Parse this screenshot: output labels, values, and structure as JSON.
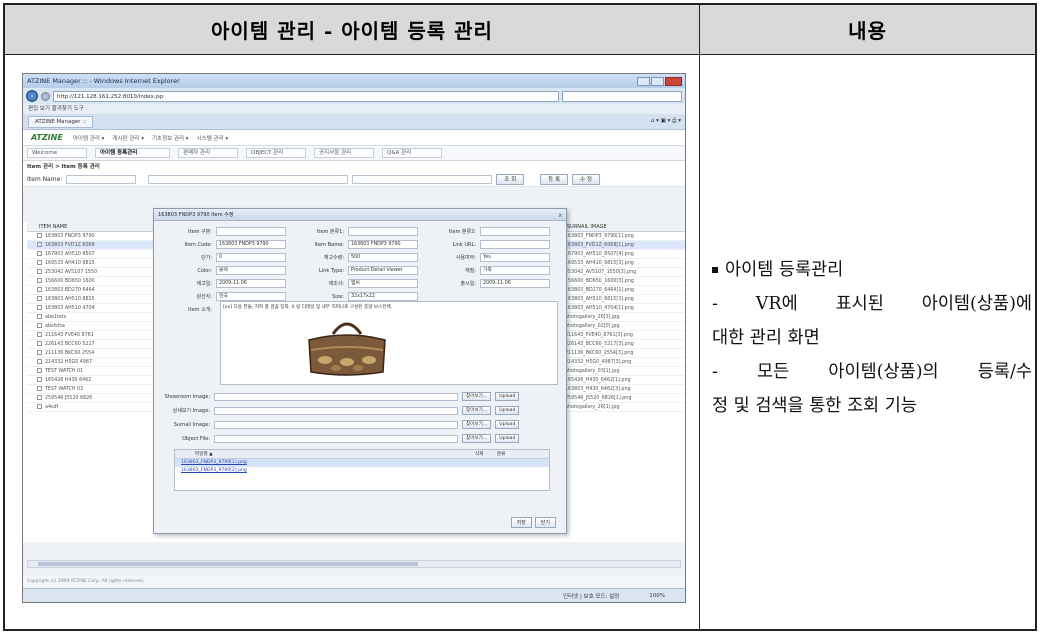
{
  "header": {
    "left_title": "아이템 관리 - 아이템 등록 관리",
    "right_title": "내용"
  },
  "description": {
    "bullet": "아이템 등록관리",
    "lines": [
      "- VR에 표시된 아이템(상품)에",
      "대한 관리 화면",
      "- 모든 아이템(상품)의 등록/수",
      "정 및 검색을 통한 조회 기능"
    ]
  },
  "screenshot": {
    "window_title": "ATZINE Manager :: - Windows Internet Explorer",
    "url": "http://121.128.161.252:8010/index.jsp",
    "menu_bar": "편집  보기  즐겨찾기  도구",
    "tab_label": "ATZINE Manager ::",
    "logo": "ATZINE",
    "nav_items": [
      "아이템 관리 ▾",
      "게시판 관리 ▾",
      "기초정보 관리 ▾",
      "시스템 관리 ▾"
    ],
    "app_tabs": [
      "Welcome",
      "아이템 등록관리",
      "판매자 관리",
      "OBJECT 관리",
      "공지사항 관리",
      "Q&A 관리"
    ],
    "breadcrumb": "Item 관리 > Item 등록 관리",
    "search_label": "Item Name:",
    "search_button": "조 회",
    "add_button": "등 록",
    "edit_button": "수 정",
    "grid_header": "ITEM NAME",
    "grid_rows": [
      "163803 FNDP3 9790",
      "163803 FVD1Z 6068",
      "167903 AH510 8507",
      "169533 AH410 9815",
      "253042 AV5107 1550",
      "156600 BD650 1600",
      "163803 BD270 6464",
      "163803 AH510 8815",
      "163803 AH510 4704",
      "abe1tets",
      "absfsfsa",
      "211643 FVE40 8761",
      "226143 BCC60 5217",
      "211136 BKC60 2554",
      "214332 H5G0 4987",
      "TEST WATCH 01",
      "165426 H430 6462",
      "TEST WATCH 03",
      "259546 J5520 6826",
      "a4sdf"
    ],
    "right_grid_header": "SURNAIL IMAGE",
    "right_grid_rows": [
      "163803_FNDP3_9790[1].png",
      "163803_FVD1Z_6068[1].png",
      "167903_AH510_8507[4].png",
      "169533_AH410_9815[3].png",
      "253042_AV5107_1550[3].png",
      "156600_BD650_1600[3].png",
      "163803_BD270_6464[1].png",
      "163803_AH510_8815[3].png",
      "163803_AH510_4704[1].png",
      "photogallery_26[3].jpg",
      "photogallery_02[0].jpg",
      "211643_FVE40_8761[3].png",
      "226143_BCC60_5217[3].png",
      "211136_BKC60_2554[3].png",
      "214332_H5G0_4987[3].png",
      "photogallery_03[1].jpg",
      "165426_H430_6462[1].png",
      "163803_H430_6462[3].png",
      "259546_J5520_6826[1].png",
      "photogallery_26[1].jpg"
    ],
    "modal": {
      "title": "163803 FNDP3 9790 Item 수정",
      "close": "x",
      "fields": {
        "item_type_label": "Item 구분:",
        "item_cat1_label": "Item 분류1:",
        "item_cat2_label": "Item 분류2:",
        "item_code_label": "Item Code:",
        "item_code": "163803 FNDP3 9790",
        "item_name_label": "Item Name:",
        "item_name": "163803 FNDP3 9790",
        "link_url_label": "Link URL:",
        "price_label": "단가:",
        "price": "0",
        "stock_label": "재고수량:",
        "stock": "500",
        "use_label": "사용여부:",
        "use": "Yes",
        "color_label": "Color:",
        "color": "블랙",
        "link_type_label": "Link Type:",
        "link_type": "Product Detail Viewer",
        "material_label": "재질:",
        "material": "가죽",
        "reg_date_label": "재고일:",
        "reg_date": "2009-11-06",
        "size_label": "재조사:",
        "size": "엠씨",
        "out_date_label": "출시일:",
        "out_date": "2009-11-06",
        "origin_label": "원산지:",
        "origin": "한국",
        "dim_label": "Size:",
        "dim": "32x17x22",
        "desc_label": "Item 소개:",
        "desc": "[xx] 다용 한들, 지퍼 를 끌끔 장착, 0 링 디테일 및 내부 지퍼나로 구성된 중량 보스턴백."
      },
      "image_rows": [
        {
          "label": "Showroom Image:",
          "browse": "찾아보기...",
          "upload": "Upload"
        },
        {
          "label": "상세보기 Image:",
          "browse": "찾아보기...",
          "upload": "Upload"
        },
        {
          "label": "Surnail Image:",
          "browse": "찾아보기...",
          "upload": "Upload"
        },
        {
          "label": "Object File:",
          "browse": "찾아보기...",
          "upload": "Upload"
        }
      ],
      "file_list_header": "파일명 ▲",
      "file_list_col2": "삭제",
      "file_list_col3": "분류",
      "file_list_rows": [
        "163803_FNDP3_9790[1].png",
        "163803_FNDP3_9790[2].png"
      ],
      "save_button": "저장",
      "close_button": "닫기"
    },
    "footer_text": "Copyright (c) 2009 ATZINE Corp. All rights reserved.",
    "status_zone": "인터넷 | 보호 모드: 설정",
    "zoom": "100%"
  },
  "colors": {
    "header_bg": "#d9d9d9",
    "border": "#222222"
  }
}
